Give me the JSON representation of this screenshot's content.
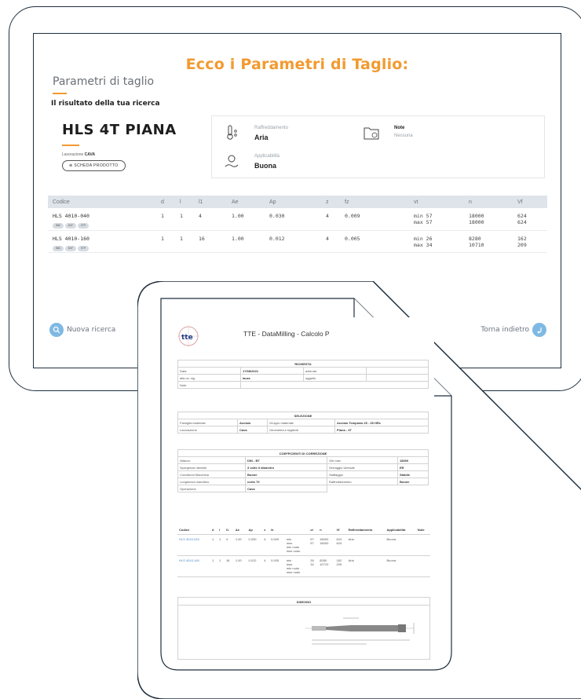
{
  "screen": {
    "heading": "Ecco i Parametri di Taglio:",
    "subtitle": "Parametri di taglio",
    "result_label": "Il risultato della tua ricerca",
    "product": {
      "name": "HLS 4T PIANA",
      "working_label": "Lavorazione",
      "working_value": "CAVA",
      "sheet_button": "SCHEDA PRODOTTO"
    },
    "info": {
      "cooling_title": "Raffreddamento",
      "cooling_value": "Aria",
      "notes_title": "Note",
      "notes_value": "Nessuna",
      "applicability_title": "Applicabilità",
      "applicability_value": "Buona"
    },
    "table": {
      "headers": [
        "Codice",
        "d",
        "l",
        "l1",
        "Ae",
        "Ap",
        "z",
        "fz",
        "vt",
        "n",
        "Vf"
      ],
      "rows": [
        {
          "code": "HLS 4010-040",
          "pills": [
            "DWG",
            "DXF",
            "STP"
          ],
          "d": "1",
          "l": "1",
          "l1": "4",
          "ae": "1.00",
          "ap": "0.030",
          "z": "4",
          "fz": "0.009",
          "vt_min": "min 57",
          "vt_max": "max 57",
          "n_min": "18000",
          "n_max": "18000",
          "vf_min": "624",
          "vf_max": "624"
        },
        {
          "code": "HLS 4010-160",
          "pills": [
            "DWG",
            "DXF",
            "STP"
          ],
          "d": "1",
          "l": "1",
          "l1": "16",
          "ae": "1.00",
          "ap": "0.012",
          "z": "4",
          "fz": "0.005",
          "vt_min": "min 26",
          "vt_max": "max 34",
          "n_min": "8280",
          "n_max": "10710",
          "vf_min": "162",
          "vf_max": "209"
        }
      ]
    },
    "nav_new": "Nuova ricerca",
    "nav_back": "Torna indietro"
  },
  "doc": {
    "logo": "tte",
    "title": "TTE - DataMilling - Calcolo P",
    "richiesta": {
      "header": "RICHIESTA",
      "data_label": "Data",
      "data_value": "17/08/2021",
      "azienda_label": "azienda",
      "alla_label": "alla ca. sig.",
      "alla_value": "laura",
      "oggetto_label": "oggetto",
      "note_label": "Note"
    },
    "selezione": {
      "header": "SELEZIONE",
      "famiglia_label": "Famiglia materiale",
      "famiglia_value": "Acciaio",
      "gruppo_label": "Gruppo materiale",
      "gruppo_value": "Acciaio Temprato 25 - 35 HRc",
      "lavorazione_label": "Lavorazione",
      "lavorazione_value": "Cava",
      "geometria_label": "Geometria e taglienti",
      "geometria_value": "Piana - 4T"
    },
    "coefficienti": {
      "header": "COEFFICIENTI DI CORREZIONE",
      "rows": [
        [
          "Attacco",
          "DIN - BT",
          "Giri max",
          "18000"
        ],
        [
          "Sporgenza utensile",
          "3 volte il diametro",
          "Serraggio Utensile",
          "ER"
        ],
        [
          "Condizioni Macchina",
          "Buone",
          "Staffaggio",
          "Stabile"
        ],
        [
          "Lunghezza mandrino",
          "corto 70",
          "Raffreddamento",
          "Buone"
        ],
        [
          "Operazione",
          "Cava",
          "",
          ""
        ]
      ]
    },
    "results": {
      "headers": [
        "Codice",
        "d",
        "l",
        "l1",
        "Ae",
        "Ap",
        "z",
        "fz",
        "",
        "vt",
        "n",
        "Vf",
        "Raffreddamento",
        "Applicabilità",
        "Note"
      ],
      "rows": [
        {
          "code": "HLS 4010-040",
          "d": "1",
          "l": "1",
          "l1": "4",
          "ae": "1.00",
          "ap": "0.030",
          "z": "4",
          "fz": "0.009",
          "modes": [
            "min",
            "max",
            "min nudo",
            "max nudo"
          ],
          "vt": [
            "57",
            "57"
          ],
          "n": [
            "18000",
            "18000"
          ],
          "vf": [
            "624",
            "624"
          ],
          "raff": "Aria",
          "app": "Buona"
        },
        {
          "code": "HLS 4010-160",
          "d": "1",
          "l": "1",
          "l1": "16",
          "ae": "1.00",
          "ap": "0.012",
          "z": "4",
          "fz": "0.005",
          "modes": [
            "min",
            "max",
            "min nudo",
            "max nudo"
          ],
          "vt": [
            "26",
            "34"
          ],
          "n": [
            "8280",
            "10710"
          ],
          "vf": [
            "162",
            "209"
          ],
          "raff": "Aria",
          "app": "Buona"
        }
      ]
    },
    "disegno": "DISEGNO"
  },
  "colors": {
    "accent": "#f29a30",
    "frame": "#1f2f3d",
    "table_header": "#dfe4ea",
    "nav_button": "#7fb9e3",
    "link": "#4e88c6"
  }
}
